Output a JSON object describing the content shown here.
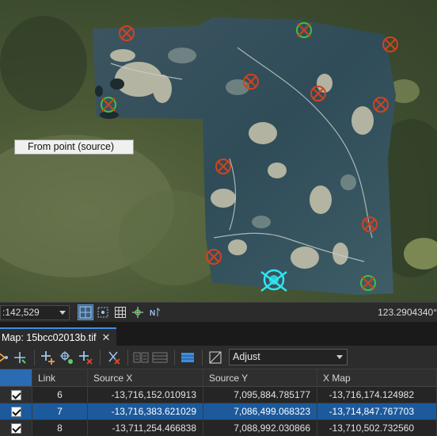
{
  "map": {
    "tooltip": "From point (source)"
  },
  "statusbar": {
    "scale_value": ":142,529",
    "coordinates": "123.2904340°"
  },
  "tab": {
    "label": "Map: 15bcc02013b.tif",
    "close_glyph": "✕"
  },
  "toolbar": {
    "transformation_value": "Adjust"
  },
  "table": {
    "columns": [
      "",
      "Link",
      "Source X",
      "Source Y",
      "X Map"
    ],
    "rows": [
      {
        "checked": true,
        "link": "6",
        "source_x": "-13,716,152.010913",
        "source_y": "7,095,884.785177",
        "x_map": "-13,716,174.124982",
        "selected": false
      },
      {
        "checked": true,
        "link": "7",
        "source_x": "-13,716,383.621029",
        "source_y": "7,086,499.068323",
        "x_map": "-13,714,847.767703",
        "selected": true
      },
      {
        "checked": true,
        "link": "8",
        "source_x": "-13,711,254.466838",
        "source_y": "7,088,992.030866",
        "x_map": "-13,710,502.732560",
        "selected": false
      }
    ]
  },
  "colors": {
    "accent": "#3d8ee0",
    "selection": "#1c5a9c",
    "control_point_red": "#d0431f",
    "control_point_green": "#3fc23a",
    "control_point_selected": "#2ee6f0"
  }
}
